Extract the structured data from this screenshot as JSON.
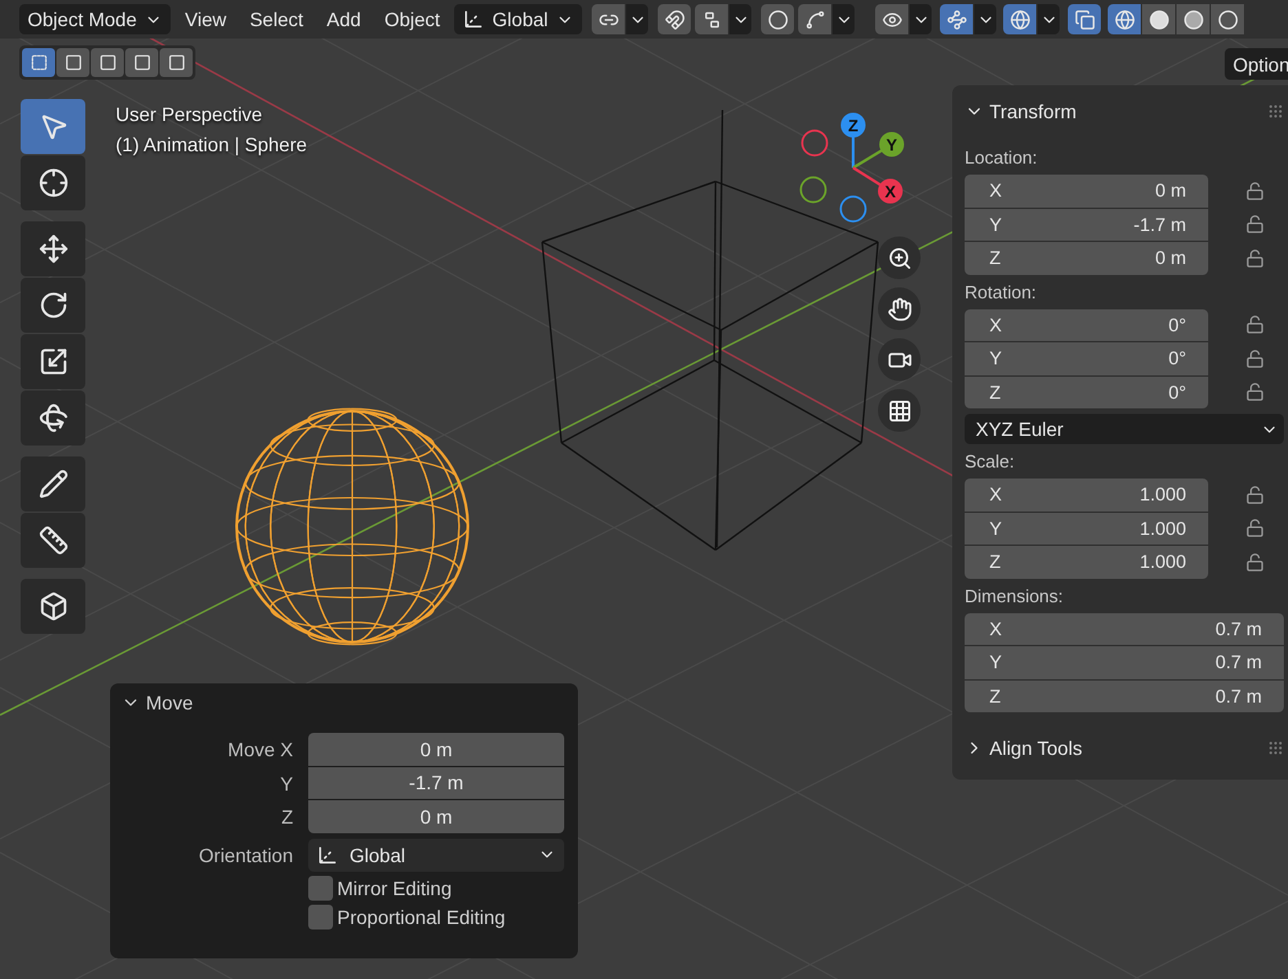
{
  "header": {
    "mode": "Object Mode",
    "menus": [
      "View",
      "Select",
      "Add",
      "Object"
    ],
    "orientation": "Global",
    "toggles": [
      {
        "kind": "link",
        "on": false
      },
      {
        "kind": "snap",
        "on": false
      },
      {
        "kind": "snap-target",
        "on": false
      },
      {
        "kind": "proportional",
        "on": false
      },
      {
        "kind": "falloff",
        "on": false
      },
      {
        "kind": "visibility",
        "on": false
      },
      {
        "kind": "gizmo",
        "on": true
      },
      {
        "kind": "overlay",
        "on": true
      },
      {
        "kind": "xray",
        "on": true
      }
    ],
    "shading": [
      {
        "kind": "wireframe",
        "selected": true
      },
      {
        "kind": "solid",
        "selected": false
      },
      {
        "kind": "material",
        "selected": false
      },
      {
        "kind": "rendered",
        "selected": false
      }
    ]
  },
  "select_modes": [
    {
      "selected": true
    },
    {
      "selected": false
    },
    {
      "selected": false
    },
    {
      "selected": false
    },
    {
      "selected": false
    }
  ],
  "viewport": {
    "title": "User Perspective",
    "subtitle": "(1) Animation | Sphere",
    "options": "Option"
  },
  "tools": [
    {
      "kind": "select",
      "selected": true
    },
    {
      "kind": "cursor",
      "selected": false
    },
    {
      "kind": "move",
      "selected": false
    },
    {
      "kind": "rotate",
      "selected": false
    },
    {
      "kind": "scale",
      "selected": false
    },
    {
      "kind": "transform",
      "selected": false
    },
    {
      "kind": "annotate",
      "selected": false
    },
    {
      "kind": "measure",
      "selected": false
    },
    {
      "kind": "add-cube",
      "selected": false
    }
  ],
  "gizmo": {
    "axes": [
      {
        "label": "Z",
        "color": "#2c8ff0"
      },
      {
        "label": "Y",
        "color": "#6ba32a"
      },
      {
        "label": "X",
        "color": "#e8344f"
      }
    ]
  },
  "transform": {
    "title": "Transform",
    "expanded": true,
    "groups": [
      {
        "label": "Location:",
        "fields": [
          {
            "axis": "X",
            "value": "0 m",
            "locked": false
          },
          {
            "axis": "Y",
            "value": "-1.7 m",
            "locked": false
          },
          {
            "axis": "Z",
            "value": "0 m",
            "locked": false
          }
        ]
      },
      {
        "label": "Rotation:",
        "fields": [
          {
            "axis": "X",
            "value": "0°",
            "locked": false
          },
          {
            "axis": "Y",
            "value": "0°",
            "locked": false
          },
          {
            "axis": "Z",
            "value": "0°",
            "locked": false
          }
        ],
        "mode": "XYZ Euler"
      },
      {
        "label": "Scale:",
        "fields": [
          {
            "axis": "X",
            "value": "1.000",
            "locked": false
          },
          {
            "axis": "Y",
            "value": "1.000",
            "locked": false
          },
          {
            "axis": "Z",
            "value": "1.000",
            "locked": false
          }
        ]
      },
      {
        "label": "Dimensions:",
        "fields": [
          {
            "axis": "X",
            "value": "0.7 m"
          },
          {
            "axis": "Y",
            "value": "0.7 m"
          },
          {
            "axis": "Z",
            "value": "0.7 m"
          }
        ]
      }
    ]
  },
  "align_tools": {
    "title": "Align Tools",
    "expanded": false
  },
  "move_panel": {
    "title": "Move",
    "expanded": true,
    "fields": [
      {
        "label": "Move X",
        "value": "0 m"
      },
      {
        "label": "Y",
        "value": "-1.7 m"
      },
      {
        "label": "Z",
        "value": "0 m"
      }
    ],
    "orientation": {
      "label": "Orientation",
      "value": "Global"
    },
    "checkboxes": [
      {
        "label": "Mirror Editing",
        "checked": false
      },
      {
        "label": "Proportional Editing",
        "checked": false
      }
    ]
  }
}
